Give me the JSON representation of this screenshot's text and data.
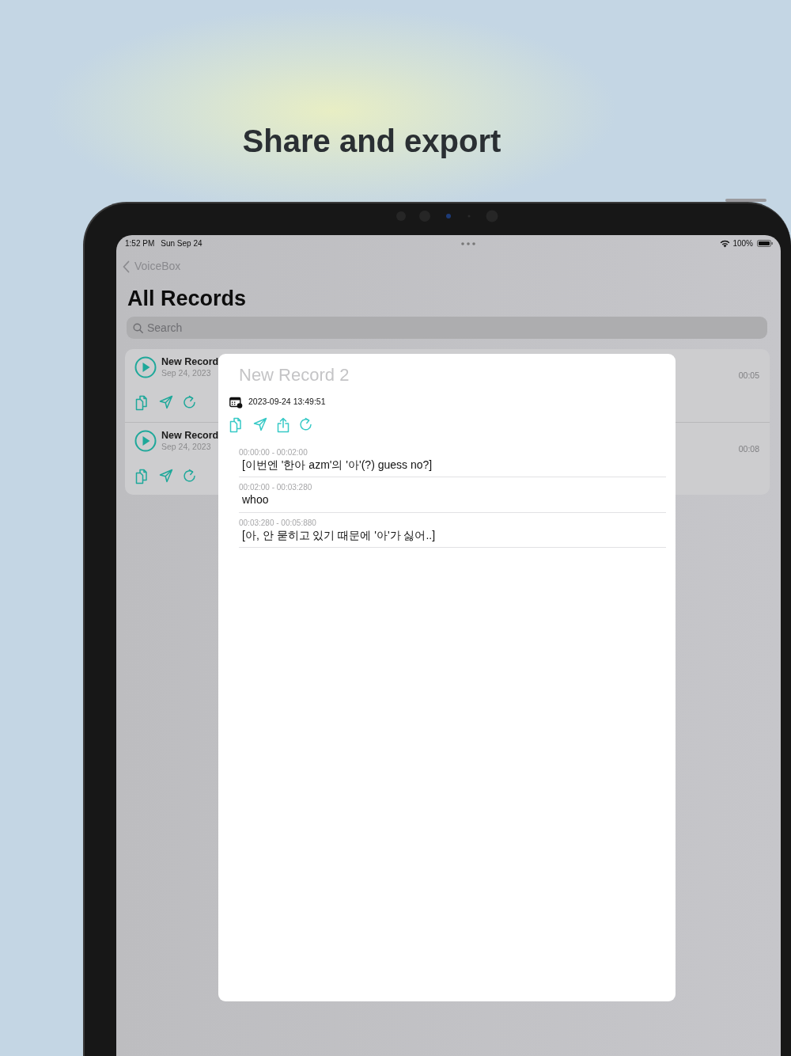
{
  "headline": "Share and export",
  "status_bar": {
    "time": "1:52 PM",
    "date": "Sun Sep 24",
    "battery": "100%"
  },
  "nav": {
    "back": "VoiceBox",
    "title": "All Records"
  },
  "search": {
    "placeholder": "Search"
  },
  "records": [
    {
      "title": "New Record",
      "date": "Sep 24, 2023",
      "duration": "00:05"
    },
    {
      "title": "New Record",
      "date": "Sep 24, 2023",
      "duration": "00:08"
    }
  ],
  "detail": {
    "title": "New Record 2",
    "timestamp": "2023-09-24 13:49:51",
    "segments": [
      {
        "time": "00:00:00 - 00:02:00",
        "text": "[이번엔 '한아 azm'의 '아'(?) guess no?]"
      },
      {
        "time": "00:02:00 - 00:03:280",
        "text": "whoo"
      },
      {
        "time": "00:03:280 - 00:05:880",
        "text": "[아, 안 묻히고 있기 때문에 '아'가 싫어..]"
      }
    ]
  }
}
